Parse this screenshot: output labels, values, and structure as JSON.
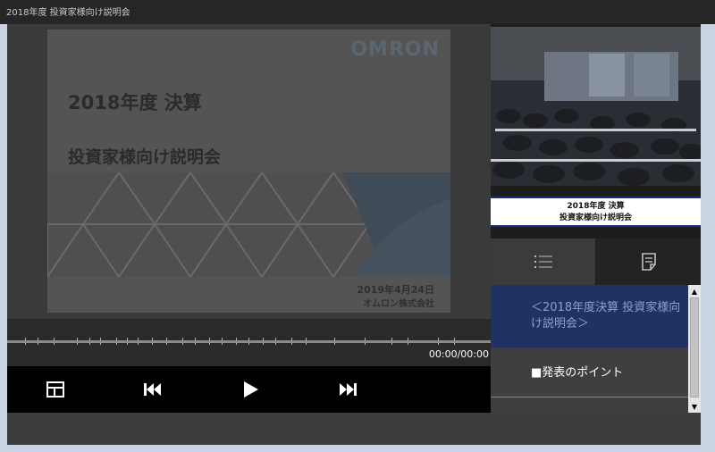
{
  "window": {
    "title": "2018年度 投資家様向け説明会"
  },
  "slide": {
    "logo": "OMRON",
    "title": "2018年度 決算",
    "subtitle": "投資家様向け説明会",
    "date": "2019年4月24日",
    "company": "オムロン株式会社"
  },
  "player": {
    "timecode": "00:00/00:00",
    "progress": 0.0,
    "buttons": {
      "layout": "layout-icon",
      "prev": "skip-previous-icon",
      "play": "play-icon",
      "next": "skip-next-icon"
    }
  },
  "side": {
    "caption_line1": "2018年度 決算",
    "caption_line2": "投資家様向け説明会",
    "tabs": [
      {
        "name": "chapter-list-tab",
        "icon": "list-icon"
      },
      {
        "name": "notes-tab",
        "icon": "notes-icon"
      }
    ],
    "chapters": [
      {
        "label": "＜2018年度決算 投資家様向け説明会＞",
        "selected": true
      },
      {
        "label": "■発表のポイント",
        "selected": false
      }
    ]
  },
  "colors": {
    "accent_blue": "#1b2f80",
    "selected_chapter_bg": "#1f3263",
    "progress": "#6aa0e8"
  }
}
